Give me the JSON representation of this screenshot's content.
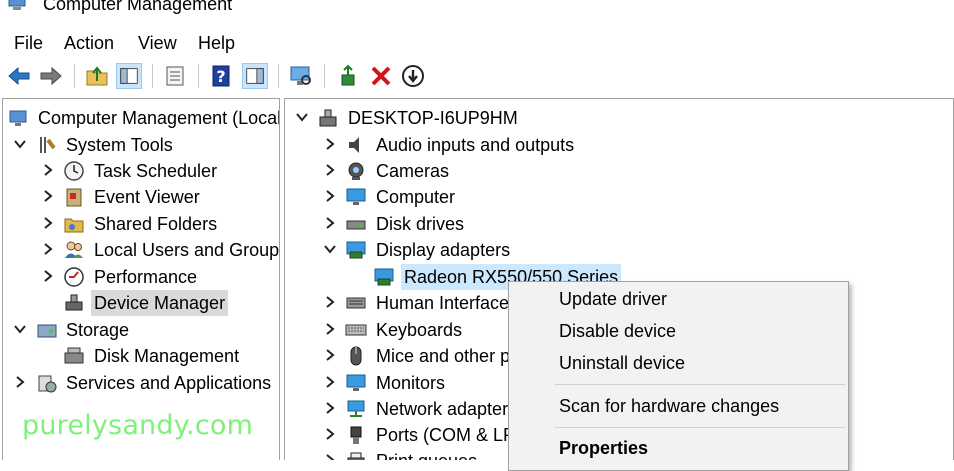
{
  "window": {
    "title": "Computer Management"
  },
  "menu": [
    "File",
    "Action",
    "View",
    "Help"
  ],
  "toolbar": {
    "buttons": [
      "back-icon",
      "forward-icon",
      "up-folder-icon",
      "show-hide-console-tree-icon",
      "export-list-icon",
      "help-icon",
      "action-pane-icon",
      "monitor-icon",
      "update-driver-icon",
      "uninstall-icon",
      "disable-icon"
    ]
  },
  "left_tree": [
    {
      "label": "Computer Management (Local",
      "icon": "computer-management-icon",
      "chevron": "none",
      "selected": false
    },
    {
      "label": "System Tools",
      "icon": "system-tools-icon",
      "chevron": "down",
      "selected": false
    },
    {
      "label": "Task Scheduler",
      "icon": "clock-icon",
      "chevron": "right",
      "selected": false
    },
    {
      "label": "Event Viewer",
      "icon": "event-viewer-icon",
      "chevron": "right",
      "selected": false
    },
    {
      "label": "Shared Folders",
      "icon": "shared-folder-icon",
      "chevron": "right",
      "selected": false
    },
    {
      "label": "Local Users and Groups",
      "icon": "users-icon",
      "chevron": "right",
      "selected": false
    },
    {
      "label": "Performance",
      "icon": "performance-icon",
      "chevron": "right",
      "selected": false
    },
    {
      "label": "Device Manager",
      "icon": "device-manager-icon",
      "chevron": "none",
      "selected": true
    },
    {
      "label": "Storage",
      "icon": "storage-icon",
      "chevron": "down",
      "selected": false
    },
    {
      "label": "Disk Management",
      "icon": "disk-management-icon",
      "chevron": "none",
      "selected": false
    },
    {
      "label": "Services and Applications",
      "icon": "services-icon",
      "chevron": "right",
      "selected": false
    }
  ],
  "right_tree": [
    {
      "label": "DESKTOP-I6UP9HM",
      "icon": "computer-tree-icon",
      "chevron": "down"
    },
    {
      "label": "Audio inputs and outputs",
      "icon": "speaker-icon",
      "chevron": "right"
    },
    {
      "label": "Cameras",
      "icon": "camera-icon",
      "chevron": "right"
    },
    {
      "label": "Computer",
      "icon": "monitor-icon",
      "chevron": "right"
    },
    {
      "label": "Disk drives",
      "icon": "disk-drive-icon",
      "chevron": "right"
    },
    {
      "label": "Display adapters",
      "icon": "display-adapter-icon",
      "chevron": "down"
    },
    {
      "label": "Radeon RX550/550 Series",
      "icon": "display-adapter-icon",
      "chevron": "none"
    },
    {
      "label": "Human Interface",
      "icon": "hid-icon",
      "chevron": "right"
    },
    {
      "label": "Keyboards",
      "icon": "keyboard-icon",
      "chevron": "right"
    },
    {
      "label": "Mice and other p",
      "icon": "mouse-icon",
      "chevron": "right"
    },
    {
      "label": "Monitors",
      "icon": "monitor-icon",
      "chevron": "right"
    },
    {
      "label": "Network adapters",
      "icon": "network-icon",
      "chevron": "right"
    },
    {
      "label": "Ports (COM & LP",
      "icon": "port-icon",
      "chevron": "right"
    },
    {
      "label": "Print queues",
      "icon": "printer-icon",
      "chevron": "right"
    }
  ],
  "context_menu": {
    "items": [
      "Update driver",
      "Disable device",
      "Uninstall device",
      "Scan for hardware changes",
      "Properties"
    ]
  },
  "watermark": "purelysandy.com",
  "colors": {
    "selection_blue": "#cce8ff",
    "selection_grey": "#d9d9d9",
    "watermark_green": "#7ff07a",
    "menu_bg": "#f2f2f2"
  }
}
